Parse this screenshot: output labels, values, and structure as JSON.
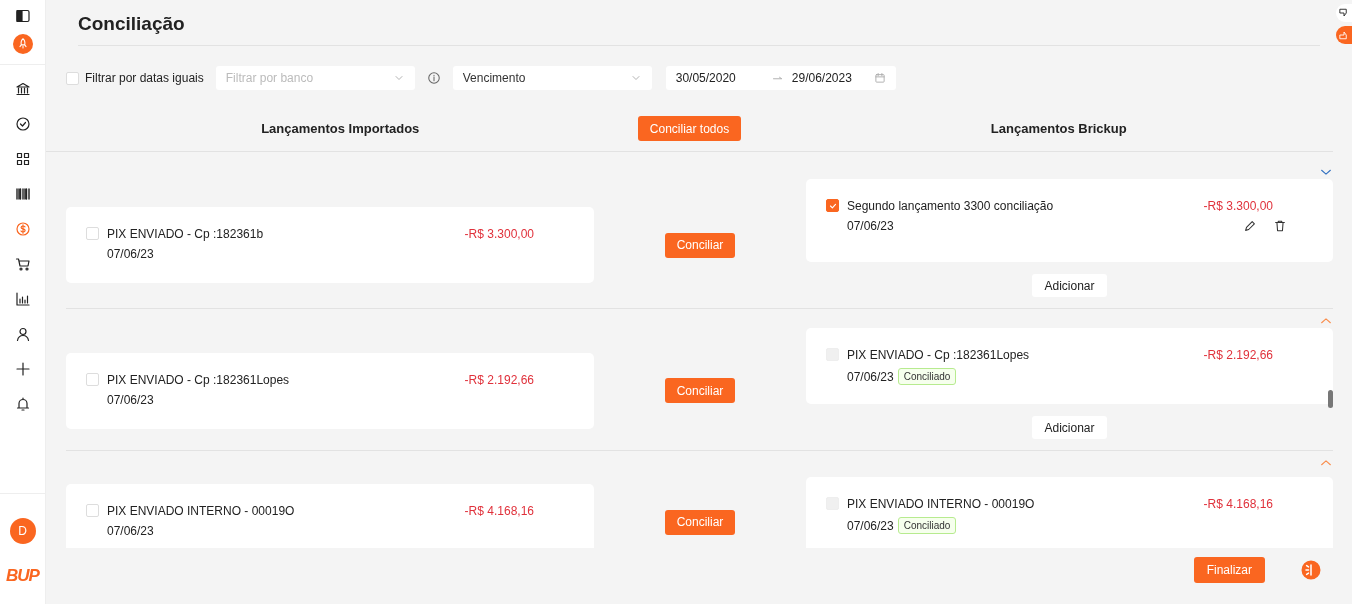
{
  "sidebar": {
    "nav": [
      {
        "selected": false
      },
      {
        "selected": false
      },
      {
        "selected": false
      },
      {
        "selected": false
      },
      {
        "selected": true
      },
      {
        "selected": false
      },
      {
        "selected": false
      },
      {
        "selected": false
      },
      {
        "selected": false
      },
      {
        "selected": false
      }
    ],
    "avatar": "D",
    "logo": "BUP"
  },
  "title": "Conciliação",
  "filters": {
    "same_dates": {
      "label": "Filtrar por datas iguais",
      "checked": false
    },
    "bank": {
      "placeholder": "Filtrar por banco"
    },
    "date_type": {
      "value": "Vencimento"
    },
    "date_from": "30/05/2020",
    "date_to": "29/06/2023"
  },
  "columns": {
    "left": "Lançamentos Importados",
    "center": "Conciliar todos",
    "right": "Lançamentos Brickup"
  },
  "groups": [
    {
      "expanded": false,
      "imported": {
        "description": "PIX ENVIADO - Cp :182361b",
        "date": "07/06/23",
        "amount": "-R$ 3.300,00",
        "checked": false
      },
      "action": "Conciliar",
      "brickup": [
        {
          "description": "Segundo lançamento 3300 conciliação",
          "date": "07/06/23",
          "amount": "-R$ 3.300,00",
          "checked": true,
          "disabled": false,
          "editable": true
        }
      ],
      "add": "Adicionar"
    },
    {
      "expanded": true,
      "imported": {
        "description": "PIX ENVIADO - Cp :182361Lopes",
        "date": "07/06/23",
        "amount": "-R$ 2.192,66",
        "checked": false
      },
      "action": "Conciliar",
      "brickup": [
        {
          "description": "PIX ENVIADO - Cp :182361Lopes",
          "date": "07/06/23",
          "amount": "-R$ 2.192,66",
          "checked": false,
          "disabled": true,
          "editable": false,
          "status": "Conciliado"
        }
      ],
      "add": "Adicionar"
    },
    {
      "expanded": true,
      "imported": {
        "description": "PIX ENVIADO INTERNO - 00019O",
        "date": "07/06/23",
        "amount": "-R$ 4.168,16",
        "checked": false
      },
      "action": "Conciliar",
      "brickup": [
        {
          "description": "PIX ENVIADO INTERNO - 00019O",
          "date": "07/06/23",
          "amount": "-R$ 4.168,16",
          "checked": false,
          "disabled": true,
          "editable": false,
          "status": "Conciliado"
        }
      ]
    }
  ],
  "finish": "Finalizar"
}
